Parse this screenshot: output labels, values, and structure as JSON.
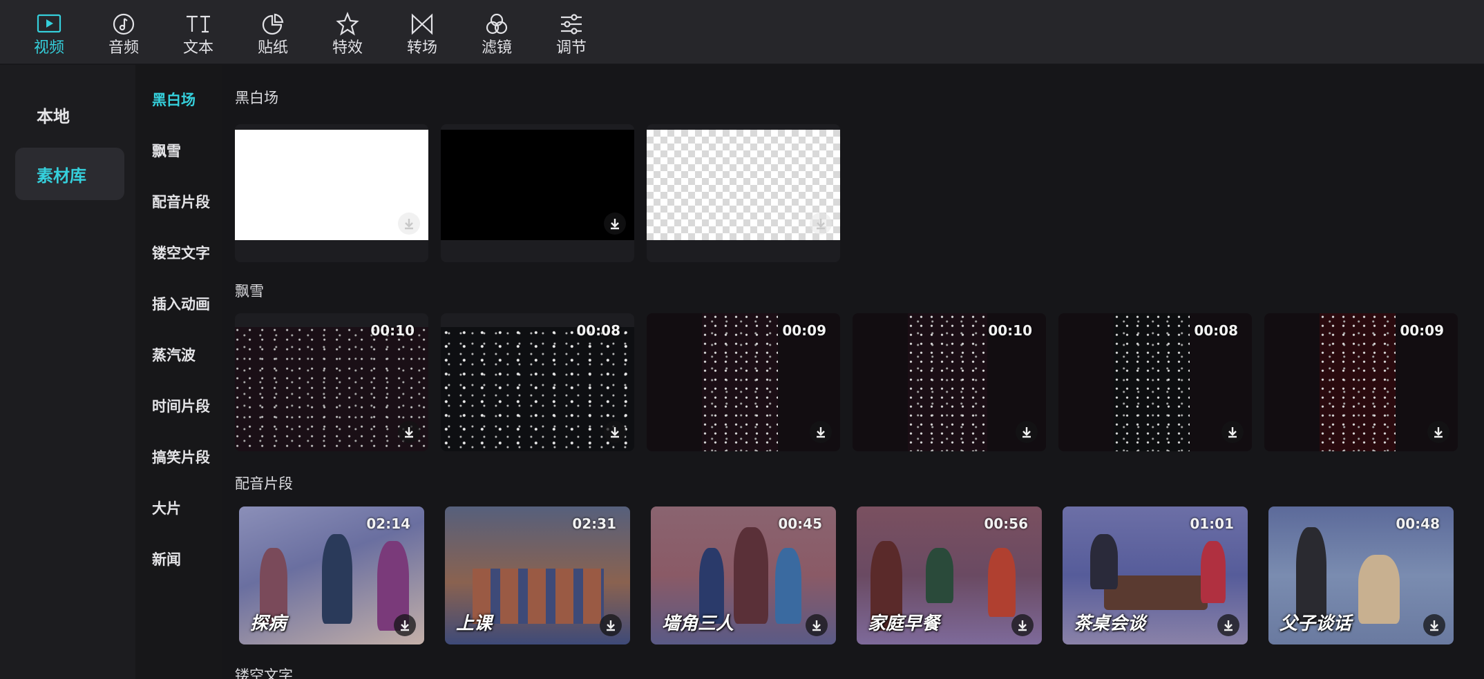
{
  "toolbar": {
    "items": [
      {
        "label": "视频",
        "icon": "video-icon",
        "active": true
      },
      {
        "label": "音频",
        "icon": "music-note-icon"
      },
      {
        "label": "文本",
        "icon": "text-icon",
        "glyph": "TI"
      },
      {
        "label": "贴纸",
        "icon": "sticker-icon"
      },
      {
        "label": "特效",
        "icon": "star-effect-icon"
      },
      {
        "label": "转场",
        "icon": "transition-icon"
      },
      {
        "label": "滤镜",
        "icon": "filter-icon"
      },
      {
        "label": "调节",
        "icon": "adjust-sliders-icon"
      }
    ],
    "accent_color": "#35d0dc"
  },
  "left_nav": {
    "items": [
      {
        "label": "本地"
      },
      {
        "label": "素材库",
        "active": true
      }
    ]
  },
  "categories": [
    {
      "label": "黑白场",
      "active": true
    },
    {
      "label": "飘雪"
    },
    {
      "label": "配音片段"
    },
    {
      "label": "镂空文字"
    },
    {
      "label": "插入动画"
    },
    {
      "label": "蒸汽波"
    },
    {
      "label": "时间片段"
    },
    {
      "label": "搞笑片段"
    },
    {
      "label": "大片"
    },
    {
      "label": "新闻"
    }
  ],
  "sections": {
    "blackwhite": {
      "title": "黑白场",
      "cards": [
        {
          "style": "white"
        },
        {
          "style": "black"
        },
        {
          "style": "transparent"
        }
      ]
    },
    "snow": {
      "title": "飘雪",
      "cards": [
        {
          "duration": "00:10"
        },
        {
          "duration": "00:08"
        },
        {
          "duration": "00:09"
        },
        {
          "duration": "00:10"
        },
        {
          "duration": "00:08"
        },
        {
          "duration": "00:09"
        }
      ]
    },
    "dubbing": {
      "title": "配音片段",
      "cards": [
        {
          "duration": "02:14",
          "title": "探病"
        },
        {
          "duration": "02:31",
          "title": "上课"
        },
        {
          "duration": "00:45",
          "title": "墙角三人"
        },
        {
          "duration": "00:56",
          "title": "家庭早餐"
        },
        {
          "duration": "01:01",
          "title": "茶桌会谈"
        },
        {
          "duration": "00:48",
          "title": "父子谈话"
        }
      ]
    },
    "hollow_text": {
      "title": "镂空文字"
    }
  }
}
